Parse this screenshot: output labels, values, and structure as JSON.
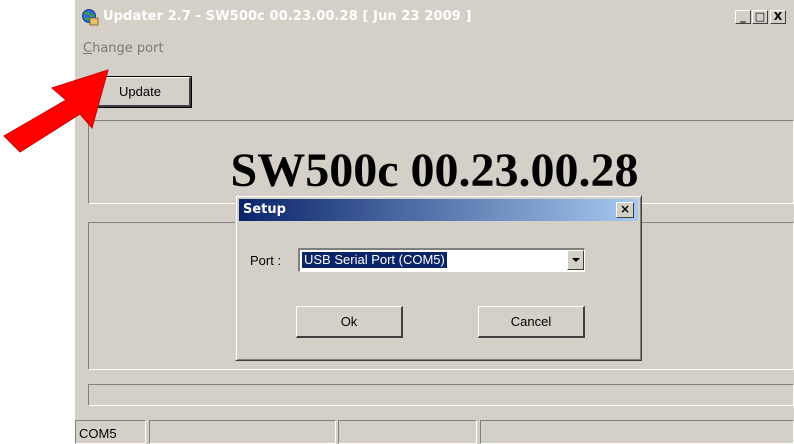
{
  "window": {
    "title": "Updater 2.7 - SW500c 00.23.00.28  [ Jun 23 2009 ]",
    "controls": {
      "minimize": "_",
      "maximize": "□",
      "close": "X"
    }
  },
  "menu": {
    "change_port": "Change port"
  },
  "toolbar": {
    "update_label": "Update"
  },
  "main": {
    "version_text": "SW500c 00.23.00.28"
  },
  "dialog": {
    "title": "Setup",
    "close_glyph": "×",
    "port_label": "Port :",
    "port_value": "USB Serial Port (COM5)",
    "ok_label": "Ok",
    "cancel_label": "Cancel"
  },
  "statusbar": {
    "port": "COM5"
  },
  "annotation": {
    "arrow_color": "#ff0000",
    "arrow_icon": "red-arrow-icon"
  },
  "colors": {
    "title_text": "#ffffff",
    "dialog_title_start": "#0a246a",
    "dialog_title_end": "#a6caf0",
    "selection": "#0a246a"
  }
}
